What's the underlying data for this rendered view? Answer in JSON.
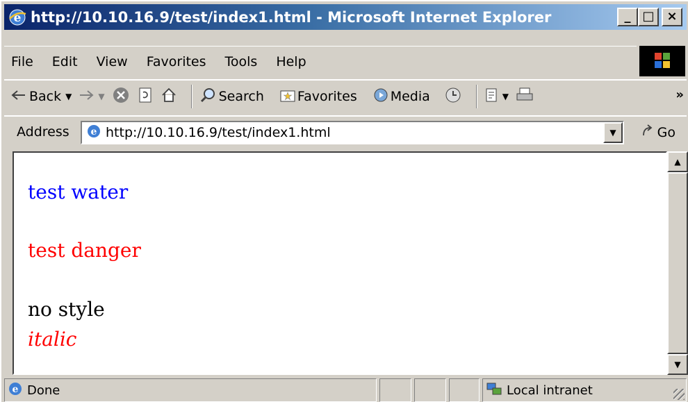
{
  "window": {
    "title": "http://10.10.16.9/test/index1.html - Microsoft Internet Explorer",
    "buttons": {
      "minimize": "_",
      "maximize": "□",
      "close": "×"
    }
  },
  "menu": {
    "items": [
      {
        "label": "File"
      },
      {
        "label": "Edit"
      },
      {
        "label": "View"
      },
      {
        "label": "Favorites"
      },
      {
        "label": "Tools"
      },
      {
        "label": "Help"
      }
    ]
  },
  "toolbar": {
    "back_label": "Back",
    "search_label": "Search",
    "favorites_label": "Favorites",
    "media_label": "Media",
    "more": "»"
  },
  "address": {
    "label": "Address",
    "value": "http://10.10.16.9/test/index1.html",
    "go_label": "Go"
  },
  "content": {
    "line1": "test water",
    "line2": "test danger",
    "line3": "no style",
    "line4": "italic"
  },
  "status": {
    "text": "Done",
    "zone": "Local intranet"
  },
  "colors": {
    "title_gradient_start": "#0a246a",
    "title_gradient_end": "#a6caf0",
    "water": "#0000ff",
    "danger": "#ff0000",
    "chrome": "#d4d0c8"
  }
}
